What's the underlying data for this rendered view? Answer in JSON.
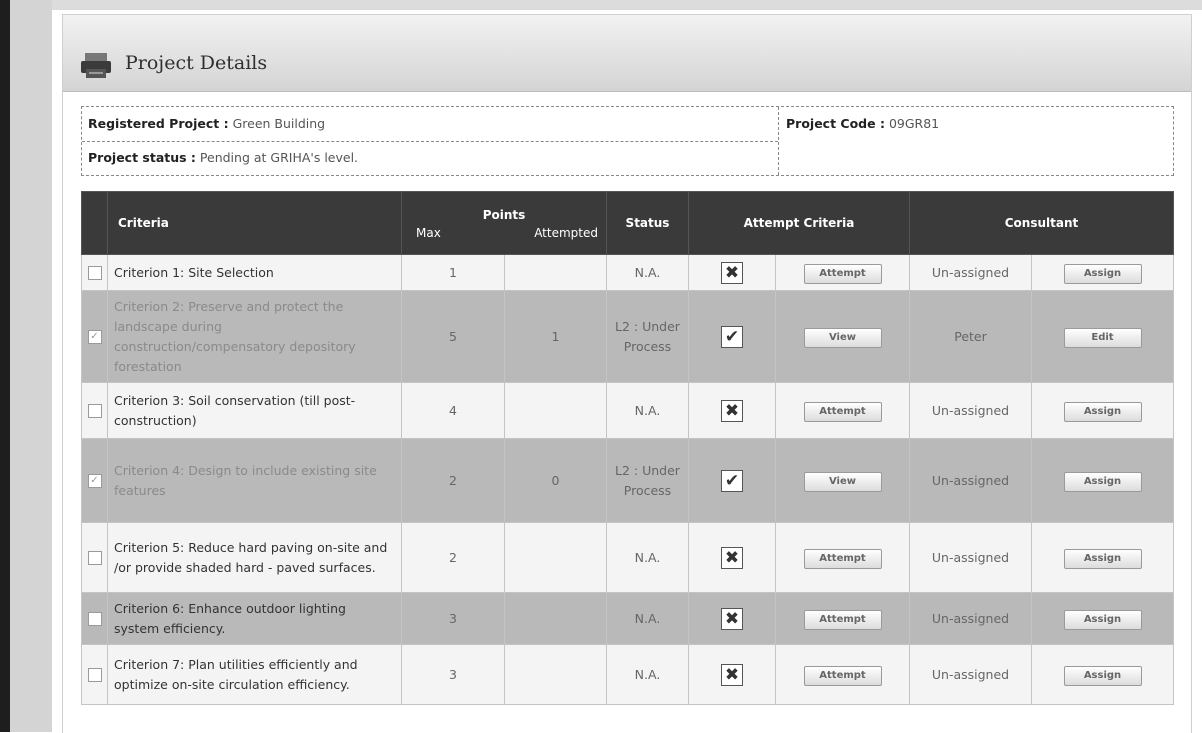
{
  "panel": {
    "title": "Project Details",
    "icon": "printer-icon"
  },
  "info": {
    "registered_label": "Registered Project :",
    "registered_value": "Green Building",
    "code_label": "Project Code :",
    "code_value": "09GR81",
    "status_label": "Project status :",
    "status_value": "Pending at GRIHA's level."
  },
  "table": {
    "headers": {
      "criteria": "Criteria",
      "points": "Points",
      "max": "Max",
      "attempted": "Attempted",
      "status": "Status",
      "attempt_criteria": "Attempt Criteria",
      "consultant": "Consultant"
    },
    "rows": [
      {
        "criterion": "Criterion 1: Site Selection",
        "max": "1",
        "attempted": "",
        "status": "N.A.",
        "mark": "x",
        "action": "Attempt",
        "consultant": "Un-assigned",
        "consultant_action": "Assign",
        "checked": false,
        "shade": "light"
      },
      {
        "criterion": "Criterion 2: Preserve and protect the landscape during construction/compensatory depository forestation",
        "max": "5",
        "attempted": "1",
        "status": "L2 : Under Process",
        "mark": "check",
        "action": "View",
        "consultant": "Peter",
        "consultant_action": "Edit",
        "checked": true,
        "shade": "dark"
      },
      {
        "criterion": "Criterion 3: Soil conservation (till post-construction)",
        "max": "4",
        "attempted": "",
        "status": "N.A.",
        "mark": "x",
        "action": "Attempt",
        "consultant": "Un-assigned",
        "consultant_action": "Assign",
        "checked": false,
        "shade": "light"
      },
      {
        "criterion": "Criterion 4: Design to include existing site features",
        "max": "2",
        "attempted": "0",
        "status": "L2 : Under Process",
        "mark": "check",
        "action": "View",
        "consultant": "Un-assigned",
        "consultant_action": "Assign",
        "checked": true,
        "shade": "dark"
      },
      {
        "criterion": "Criterion 5: Reduce hard paving on-site and /or provide shaded hard - paved surfaces.",
        "max": "2",
        "attempted": "",
        "status": "N.A.",
        "mark": "x",
        "action": "Attempt",
        "consultant": "Un-assigned",
        "consultant_action": "Assign",
        "checked": false,
        "shade": "light"
      },
      {
        "criterion": "Criterion 6: Enhance outdoor lighting system efficiency.",
        "max": "3",
        "attempted": "",
        "status": "N.A.",
        "mark": "x",
        "action": "Attempt",
        "consultant": "Un-assigned",
        "consultant_action": "Assign",
        "checked": false,
        "shade": "dark"
      },
      {
        "criterion": "Criterion 7: Plan utilities efficiently and optimize on-site circulation efficiency.",
        "max": "3",
        "attempted": "",
        "status": "N.A.",
        "mark": "x",
        "action": "Attempt",
        "consultant": "Un-assigned",
        "consultant_action": "Assign",
        "checked": false,
        "shade": "light"
      }
    ]
  }
}
